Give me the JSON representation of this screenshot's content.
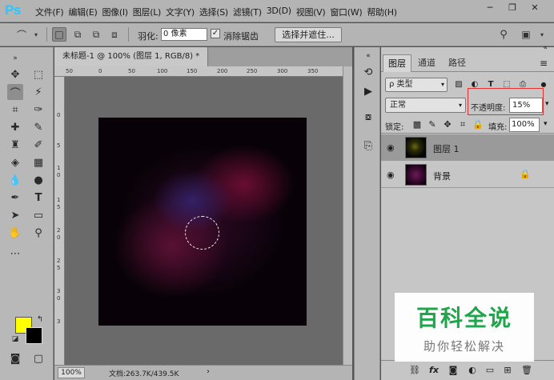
{
  "app": {
    "logo": "Ps"
  },
  "menu": [
    "文件(F)",
    "编辑(E)",
    "图像(I)",
    "图层(L)",
    "文字(Y)",
    "选择(S)",
    "滤镜(T)",
    "3D(D)",
    "视图(V)",
    "窗口(W)",
    "帮助(H)"
  ],
  "options": {
    "feather_label": "羽化:",
    "feather_value": "0 像素",
    "antialias_label": "消除锯齿",
    "antialias_checked": true,
    "select_mask_label": "选择并遮住..."
  },
  "document": {
    "tab_title": "未标题-1 @ 100% (图层 1, RGB/8) *",
    "ruler_h": [
      "50",
      "0",
      "50",
      "100",
      "150",
      "200",
      "250",
      "300",
      "350"
    ],
    "ruler_v": [
      "0",
      "5",
      "1",
      "0",
      "1",
      "5",
      "2",
      "0",
      "2",
      "5",
      "3",
      "0",
      "3"
    ],
    "zoom": "100%",
    "doc_info": "文档:263.7K/439.5K"
  },
  "colors": {
    "foreground": "#ffff00",
    "background": "#000000",
    "highlight": "#e83030"
  },
  "layers_panel": {
    "tabs": [
      "图层",
      "通道",
      "路径"
    ],
    "filter_label": "ρ 类型",
    "blend_mode": "正常",
    "opacity_label": "不透明度:",
    "opacity_value": "15%",
    "lock_label": "锁定:",
    "fill_label": "填充:",
    "fill_value": "100%",
    "layers": [
      {
        "name": "图层 1",
        "selected": true,
        "visible": true,
        "locked": false
      },
      {
        "name": "背景",
        "selected": false,
        "visible": true,
        "locked": true
      }
    ]
  },
  "watermark": {
    "title": "百科全说",
    "subtitle": "助你轻松解决"
  }
}
